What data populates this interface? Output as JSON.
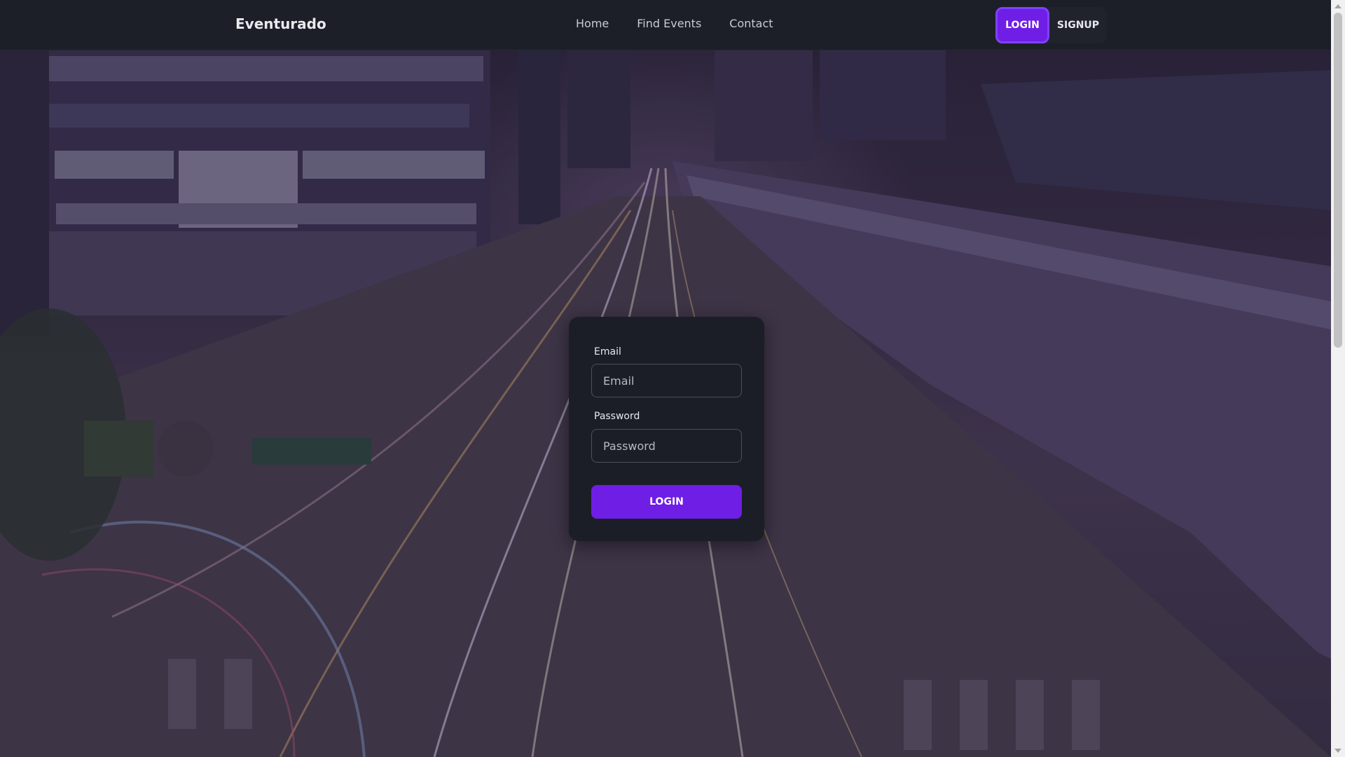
{
  "navbar": {
    "brand": "Eventurado",
    "links": [
      "Home",
      "Find Events",
      "Contact"
    ],
    "login_label": "LOGIN",
    "signup_label": "SIGNUP"
  },
  "login_form": {
    "email_label": "Email",
    "email_placeholder": "Email",
    "email_value": "",
    "password_label": "Password",
    "password_placeholder": "Password",
    "password_value": "",
    "submit_label": "LOGIN"
  },
  "colors": {
    "accent": "#6f1ee6",
    "navbar_bg": "#1c1f27",
    "card_bg": "#1b1e26"
  }
}
